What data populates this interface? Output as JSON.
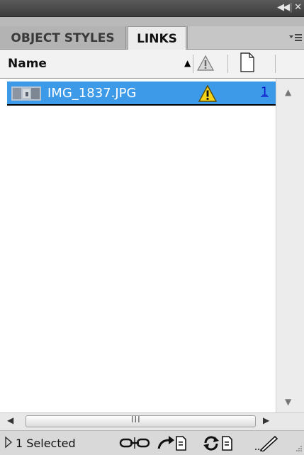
{
  "window": {
    "collapse_glyph": "◀◀",
    "separator": "|",
    "close_glyph": "✕"
  },
  "tabs": [
    {
      "label": "OBJECT STYLES",
      "active": false
    },
    {
      "label": "LINKS",
      "active": true
    }
  ],
  "panel_menu_icon": "panel-menu-icon",
  "columns": {
    "name_label": "Name",
    "sort_direction": "ascending",
    "status_icon": "warning-icon",
    "page_icon": "page-icon"
  },
  "links": [
    {
      "name": "IMG_1837.JPG",
      "thumbnail_icon": "image-thumbnail-icon",
      "status_icon": "warning-icon",
      "page": "1",
      "selected": true
    }
  ],
  "status": {
    "selected_text": "1 Selected"
  },
  "footer_icons": [
    "relink-icon",
    "go-to-link-icon",
    "update-link-icon",
    "edit-original-icon"
  ],
  "colors": {
    "selection": "#3d9ae8",
    "warning_yellow": "#f5d31a",
    "page_link": "#0a1acb",
    "titlebar": "#444444"
  }
}
